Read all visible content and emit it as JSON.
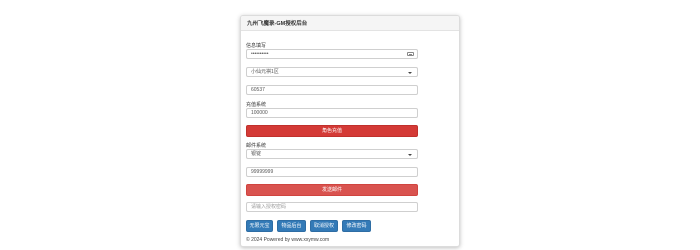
{
  "panel": {
    "title": "九州飞魔录-GM授权后台"
  },
  "account": {
    "label": "信息填写",
    "password_value": "••••••••••",
    "server_select": "小仙元祺1区",
    "role_id": "60537"
  },
  "recharge": {
    "label": "充值系统",
    "amount": "100000",
    "button_label": "角色充值"
  },
  "mail": {
    "label": "邮件系统",
    "item_select": "银锭",
    "quantity": "99999999",
    "button_label": "发送邮件"
  },
  "authcode": {
    "placeholder": "请输入授权密码"
  },
  "actions": [
    {
      "label": "无限元宝"
    },
    {
      "label": "物品后台"
    },
    {
      "label": "取消授权"
    },
    {
      "label": "修改密码"
    }
  ],
  "footer": {
    "text": "© 2024 Powered by www.xxymw.com"
  },
  "colors": {
    "danger": "#d43a36",
    "primary": "#337ab7"
  }
}
